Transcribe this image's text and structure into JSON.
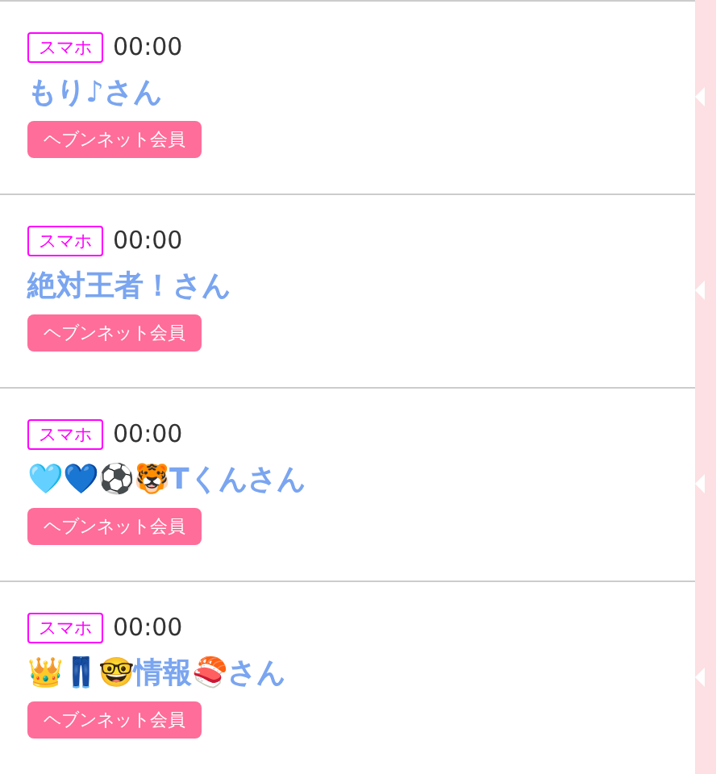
{
  "entries": [
    {
      "device": "スマホ",
      "time": "00:00",
      "name": "もり♪さん",
      "badge": "ヘブンネット会員"
    },
    {
      "device": "スマホ",
      "time": "00:00",
      "name": "絶対王者！さん",
      "badge": "ヘブンネット会員"
    },
    {
      "device": "スマホ",
      "time": "00:00",
      "name": "🩵💙⚽🐯Tくんさん",
      "badge": "ヘブンネット会員"
    },
    {
      "device": "スマホ",
      "time": "00:00",
      "name": "👑👖🤓情報🍣さん",
      "badge": "ヘブンネット会員"
    }
  ]
}
